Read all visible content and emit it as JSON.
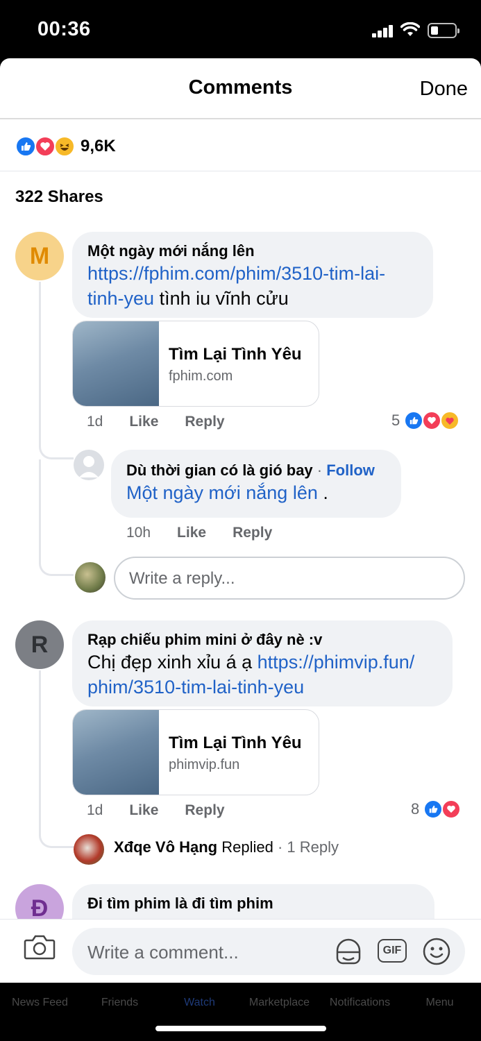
{
  "status_bar": {
    "time": "00:36"
  },
  "header": {
    "title": "Comments",
    "done_label": "Done"
  },
  "reactions": {
    "count": "9,6K",
    "icons": [
      "like-icon",
      "love-icon",
      "haha-icon"
    ]
  },
  "shares_label": "322 Shares",
  "comments": [
    {
      "avatar_letter": "M",
      "avatar_color": "#f7d38a",
      "author": "Một ngày mới nắng lên",
      "link_text": "https://fphim.com/phim/3510-tim-lai-tinh-yeu",
      "link_line1": "https://fphim.com/phim/3510-tim-lai-",
      "link_line2": "tinh-yeu",
      "text_after": " tình iu vĩnh cửu",
      "card_title": "Tìm Lại Tình Yêu",
      "card_domain": "fphim.com",
      "time": "1d",
      "like_label": "Like",
      "reply_label": "Reply",
      "reaction_count": "5"
    },
    {
      "avatar_letter": "R",
      "avatar_color": "#7c7f85",
      "author": "Rạp chiếu phim mini ở đây nè :v",
      "text_before": "Chị đẹp xinh xỉu á ạ ",
      "link_line1": "https://phimvip.fun/",
      "link_line2": "phim/3510-tim-lai-tinh-yeu",
      "card_title": "Tìm Lại Tình Yêu",
      "card_domain": "phimvip.fun",
      "time": "1d",
      "like_label": "Like",
      "reply_label": "Reply",
      "reaction_count": "8"
    },
    {
      "avatar_letter": "Đ",
      "avatar_color": "#c9a4dd",
      "author": "Đi tìm phim là đi tìm phim"
    }
  ],
  "reply": {
    "author": "Dù thời gian có là gió bay",
    "follow_label": "Follow",
    "mention": "Một ngày mới nắng lên",
    "suffix": " .",
    "time": "10h",
    "like_label": "Like",
    "reply_label": "Reply"
  },
  "reply_input_placeholder": "Write a reply...",
  "replied_summary": {
    "author": "Xđqe Vô Hạng",
    "action": " Replied",
    "sep": " · ",
    "count": "1 Reply"
  },
  "composer": {
    "placeholder": "Write a comment...",
    "gif_label": "GIF"
  },
  "tabs": [
    "News Feed",
    "Friends",
    "Watch",
    "Marketplace",
    "Notifications",
    "Menu"
  ],
  "colors": {
    "link": "#2062c7",
    "like": "#1877f2",
    "love": "#f33e58",
    "haha": "#f7b928"
  }
}
